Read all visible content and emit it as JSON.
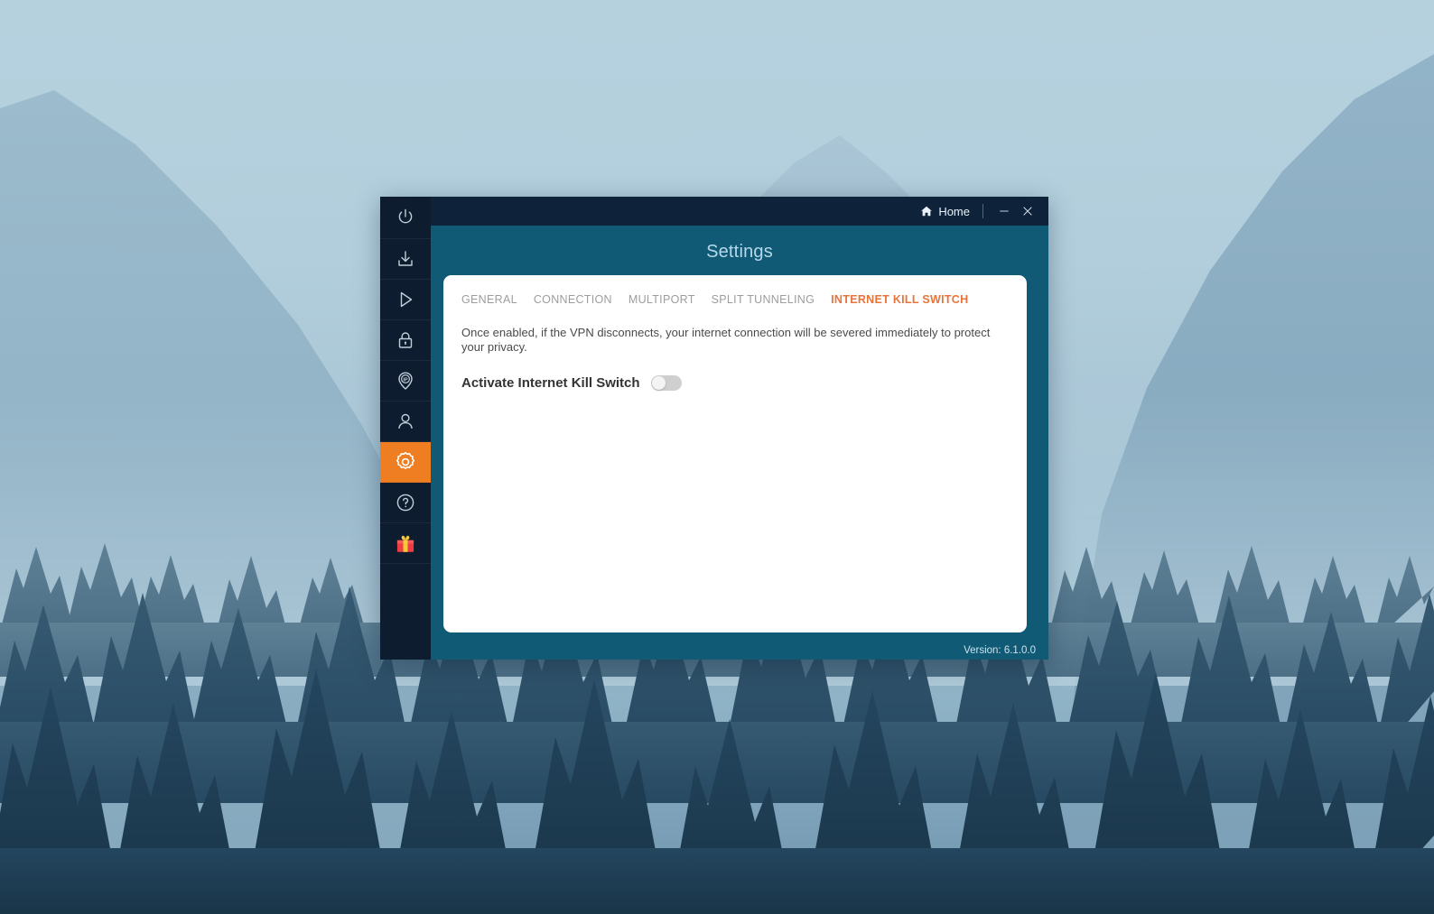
{
  "desktop": {
    "wallpaper_description": "Foggy mountain valley with pine forest",
    "colors": {
      "sky": "#b6d1de",
      "mountain": "#8fb0c4",
      "forest": "#2e4f65",
      "forest_dark": "#22415a"
    }
  },
  "app": {
    "colors": {
      "sidebar": "#0d1c2e",
      "titlebar": "#0e2339",
      "body": "#115a75",
      "accent": "#ef7d22",
      "tab_active": "#e8743c",
      "panel": "#ffffff"
    },
    "titlebar": {
      "home_label": "Home",
      "minimize_label": "Minimize",
      "close_label": "Close"
    },
    "header_title": "Settings",
    "sidebar_items": [
      {
        "name": "power",
        "label": "Power",
        "active": false
      },
      {
        "name": "download",
        "label": "Download",
        "active": false
      },
      {
        "name": "streaming",
        "label": "Streaming",
        "active": false
      },
      {
        "name": "lock",
        "label": "Security",
        "active": false
      },
      {
        "name": "ip",
        "label": "IP",
        "active": false
      },
      {
        "name": "account",
        "label": "Account",
        "active": false
      },
      {
        "name": "settings",
        "label": "Settings",
        "active": true
      },
      {
        "name": "help",
        "label": "Help",
        "active": false
      },
      {
        "name": "gift",
        "label": "Gift",
        "active": false
      }
    ],
    "tabs": [
      {
        "label": "GENERAL",
        "active": false
      },
      {
        "label": "CONNECTION",
        "active": false
      },
      {
        "label": "MULTIPORT",
        "active": false
      },
      {
        "label": "SPLIT TUNNELING",
        "active": false
      },
      {
        "label": "INTERNET KILL SWITCH",
        "active": true
      }
    ],
    "kill_switch": {
      "description": "Once enabled, if the VPN disconnects, your internet connection will be severed immediately to protect your privacy.",
      "toggle_label": "Activate Internet Kill Switch",
      "toggle_state": "off"
    },
    "version_text": "Version: 6.1.0.0"
  }
}
